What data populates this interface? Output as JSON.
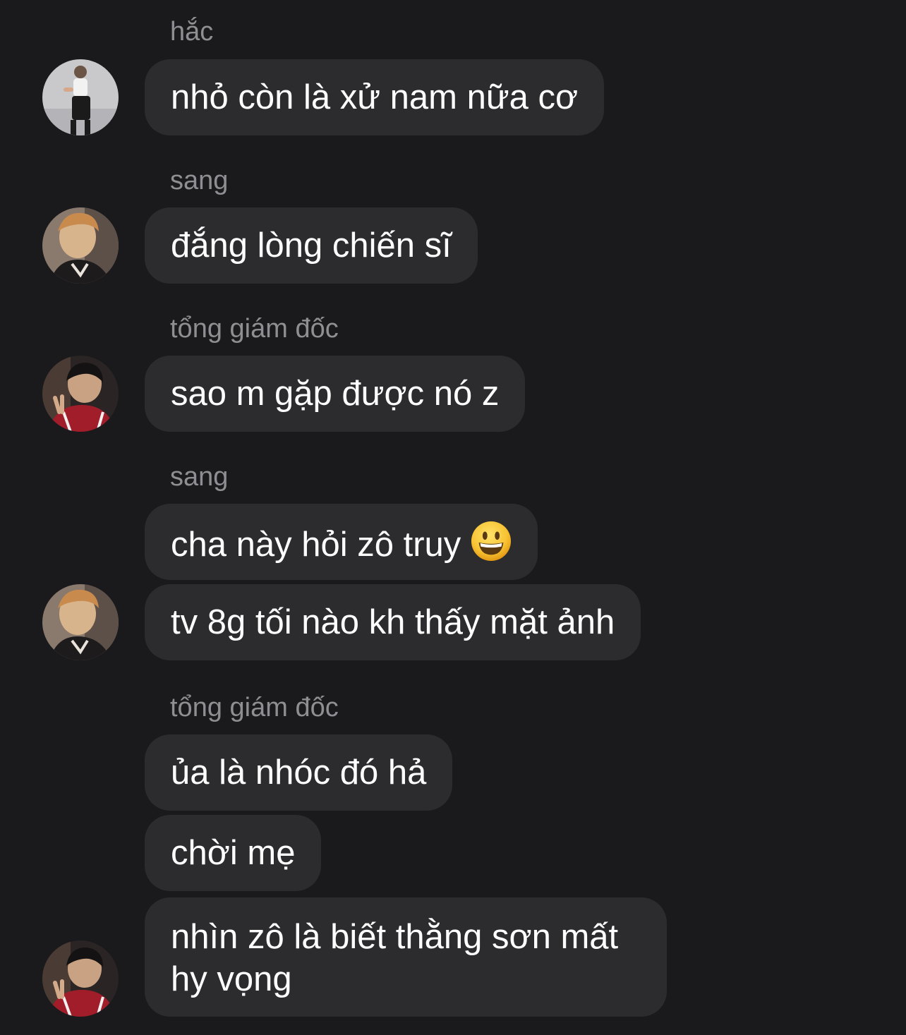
{
  "conversation": {
    "groups": [
      {
        "sender": "hắc",
        "messages": [
          "nhỏ còn là xử nam nữa cơ"
        ]
      },
      {
        "sender": "sang",
        "messages": [
          "đắng lòng chiến sĩ"
        ]
      },
      {
        "sender": "tổng giám đốc",
        "messages": [
          "sao m gặp được nó z"
        ]
      },
      {
        "sender": "sang",
        "messages": [
          "cha này hỏi zô truy",
          "tv 8g tối nào kh thấy mặt ảnh"
        ],
        "emoji": "grinning-face-emoji"
      },
      {
        "sender": "tổng giám đốc",
        "messages": [
          "ủa là nhóc đó hả",
          "chời mẹ",
          "nhìn zô là biết thằng sơn mất hy vọng"
        ]
      }
    ]
  },
  "colors": {
    "background": "#1a1a1d",
    "bubble": "#2c2c2e",
    "text": "#ffffff",
    "sender": "#8e8e93"
  }
}
